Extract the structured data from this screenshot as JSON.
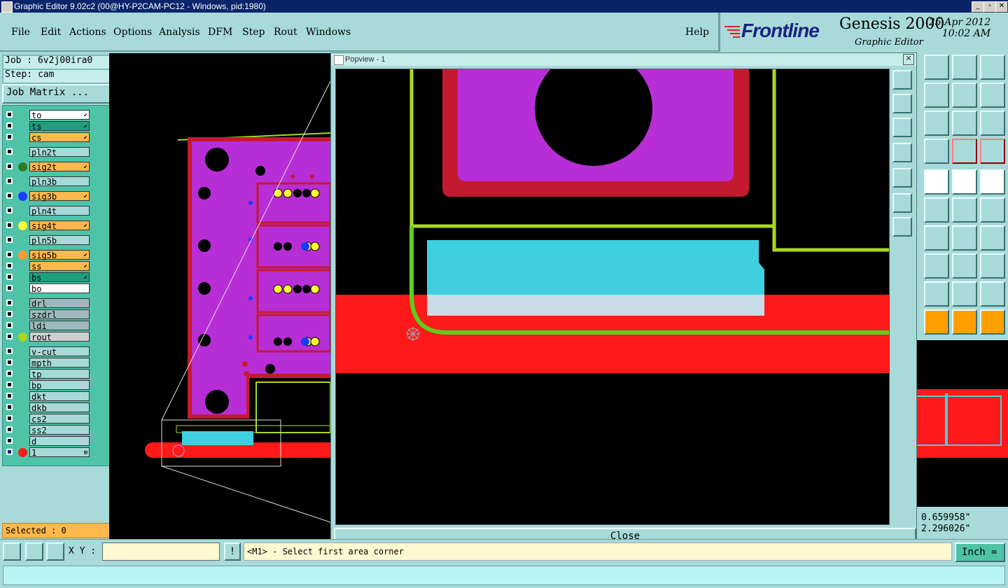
{
  "window": {
    "title": "Graphic Editor 9.02c2 (00@HY-P2CAM-PC12 - Windows, pid:1980)",
    "min": "_",
    "max": "▫",
    "close": "✕"
  },
  "menu": {
    "file": "File",
    "edit": "Edit",
    "actions": "Actions",
    "options": "Options",
    "analysis": "Analysis",
    "dfm": "DFM",
    "step": "Step",
    "rout": "Rout",
    "windows": "Windows",
    "help": "Help"
  },
  "brand": {
    "logo": "Frontline",
    "product": "Genesis 2000",
    "module": "Graphic Editor",
    "date": "25 Apr 2012",
    "time": "10:02 AM"
  },
  "job": {
    "job_label": "Job : 6v2j00ira0",
    "step_label": "Step: cam",
    "job_matrix": "Job Matrix ..."
  },
  "layers": [
    {
      "name": "to",
      "bg": "#ffffff",
      "dot": "",
      "arrow": "⬋"
    },
    {
      "name": "ts",
      "bg": "#1f9e80",
      "dot": "",
      "arrow": "⬋"
    },
    {
      "name": "cs",
      "bg": "#ffb84d",
      "dot": "",
      "arrow": "⬋"
    },
    {
      "name": "pln2t",
      "bg": "#a8dada",
      "dot": "",
      "arrow": ""
    },
    {
      "name": "sig2t",
      "bg": "#ffb84d",
      "dot": "#2e7d1e",
      "arrow": "⬋"
    },
    {
      "name": "pln3b",
      "bg": "#a8dada",
      "dot": "",
      "arrow": ""
    },
    {
      "name": "sig3b",
      "bg": "#ffb84d",
      "dot": "#1a3cff",
      "arrow": "⬋"
    },
    {
      "name": "pln4t",
      "bg": "#a8dada",
      "dot": "",
      "arrow": ""
    },
    {
      "name": "sig4t",
      "bg": "#ffb84d",
      "dot": "#ffff33",
      "arrow": "⬋"
    },
    {
      "name": "pln5b",
      "bg": "#a8dada",
      "dot": "",
      "arrow": ""
    },
    {
      "name": "sig5b",
      "bg": "#ffb84d",
      "dot": "#ff9933",
      "arrow": "⬋"
    },
    {
      "name": "ss",
      "bg": "#ffb84d",
      "dot": "",
      "arrow": "⬋"
    },
    {
      "name": "bs",
      "bg": "#1f9e80",
      "dot": "",
      "arrow": "⬋"
    },
    {
      "name": "bo",
      "bg": "#ffffff",
      "dot": "",
      "arrow": ""
    },
    {
      "name": "drl",
      "bg": "#9fb8c0",
      "dot": "",
      "arrow": ""
    },
    {
      "name": "szdrl",
      "bg": "#9fb8c0",
      "dot": "",
      "arrow": ""
    },
    {
      "name": "ldi",
      "bg": "#9fb8c0",
      "dot": "",
      "arrow": ""
    },
    {
      "name": "rout",
      "bg": "#d0d0d0",
      "dot": "#a8d820",
      "arrow": ""
    },
    {
      "name": "v-cut",
      "bg": "#a8dada",
      "dot": "",
      "arrow": ""
    },
    {
      "name": "mpth",
      "bg": "#a8dada",
      "dot": "",
      "arrow": ""
    },
    {
      "name": "tp",
      "bg": "#a8dada",
      "dot": "",
      "arrow": ""
    },
    {
      "name": "bp",
      "bg": "#a8dada",
      "dot": "",
      "arrow": ""
    },
    {
      "name": "dkt",
      "bg": "#a8dada",
      "dot": "",
      "arrow": ""
    },
    {
      "name": "dkb",
      "bg": "#a8dada",
      "dot": "",
      "arrow": ""
    },
    {
      "name": "cs2",
      "bg": "#a8dada",
      "dot": "",
      "arrow": ""
    },
    {
      "name": "ss2",
      "bg": "#a8dada",
      "dot": "",
      "arrow": ""
    },
    {
      "name": "d",
      "bg": "#a8dada",
      "dot": "",
      "arrow": ""
    },
    {
      "name": "1",
      "bg": "#a8dada",
      "dot": "#ff1a1a",
      "arrow": "⊞"
    }
  ],
  "selected": "Selected : 0",
  "popview": {
    "title": "Popview - 1",
    "close_x": "✕",
    "close_button": "Close"
  },
  "coords": {
    "x": "0.659958\"",
    "y": "2.296026\""
  },
  "bottom": {
    "xy_label": "X Y :",
    "xy_value": "",
    "excl": "!",
    "prompt": "<M1> - Select first area corner",
    "units": "Inch ="
  },
  "colors": {
    "board_magenta": "#b82ed6",
    "copper_red": "#ff1a1a",
    "rout_green": "#a8d820",
    "cyan_pad": "#3fd0e0"
  }
}
